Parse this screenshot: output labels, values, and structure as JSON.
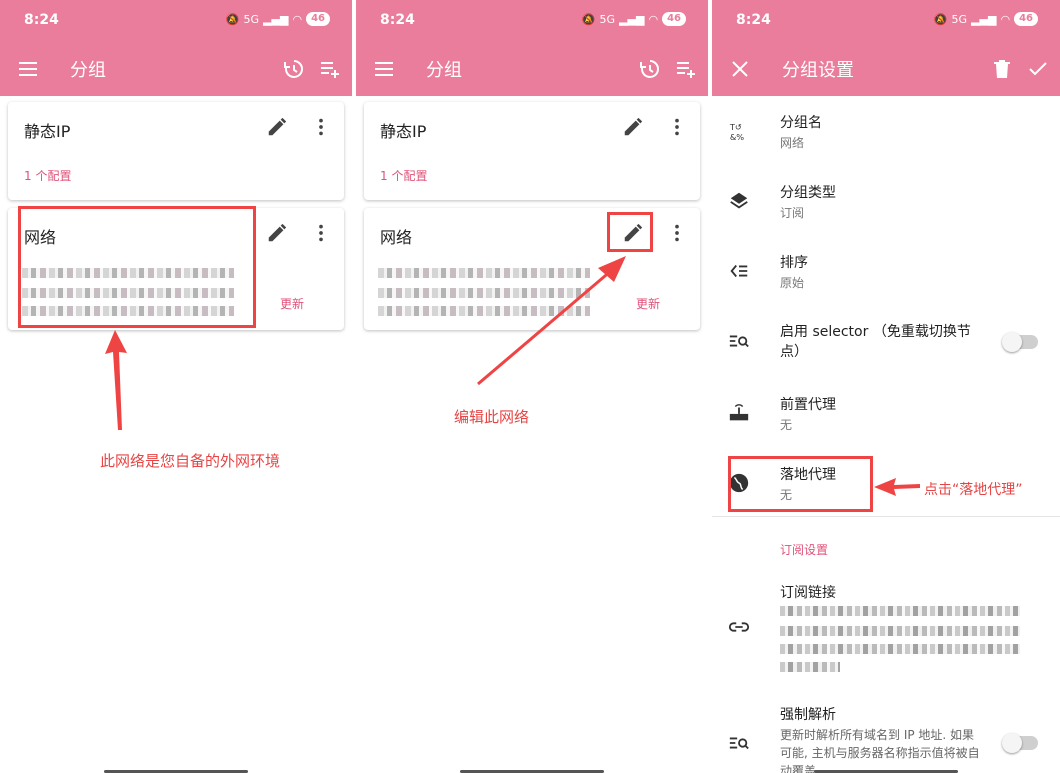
{
  "status": {
    "time": "8:24",
    "network": "5G",
    "battery": "46"
  },
  "groups_screen": {
    "title": "分组",
    "cards": [
      {
        "name": "静态IP",
        "subtitle": "1 个配置"
      },
      {
        "name": "网络",
        "action": "更新"
      }
    ]
  },
  "settings_screen": {
    "title": "分组设置",
    "rows": [
      {
        "title": "分组名",
        "value": "网络",
        "icon": "rename-icon"
      },
      {
        "title": "分组类型",
        "value": "订阅",
        "icon": "layers-icon"
      },
      {
        "title": "排序",
        "value": "原始",
        "icon": "sort-icon"
      },
      {
        "title": "启用 selector （免重载切换节点）",
        "icon": "selector-icon",
        "toggle": false
      },
      {
        "title": "前置代理",
        "value": "无",
        "icon": "router-icon"
      },
      {
        "title": "落地代理",
        "value": "无",
        "icon": "globe-icon"
      }
    ],
    "section_label": "订阅设置",
    "subscription": {
      "title": "订阅链接",
      "icon": "link-icon"
    },
    "force_resolve": {
      "title": "强制解析",
      "description": "更新时解析所有域名到 IP 地址. 如果可能, 主机与服务器名称指示值将被自动覆盖",
      "icon": "resolve-icon",
      "toggle": false
    }
  },
  "annotations": {
    "own_network": "此网络是您自备的外网环境",
    "edit_network": "编辑此网络",
    "click_landing": "点击“落地代理”"
  },
  "colors": {
    "primary": "#e97d9b",
    "accent": "#e0527a",
    "annotation": "#e64545"
  }
}
